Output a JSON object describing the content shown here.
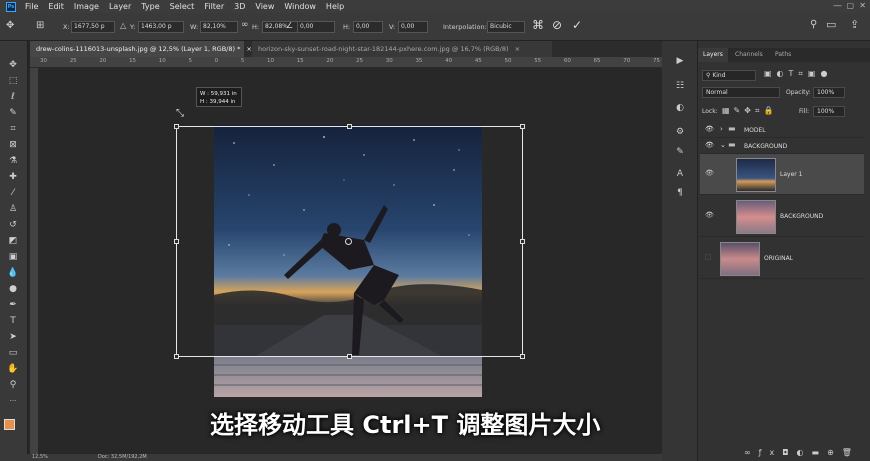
{
  "menu": [
    "File",
    "Edit",
    "Image",
    "Layer",
    "Type",
    "Select",
    "Filter",
    "3D",
    "View",
    "Window",
    "Help"
  ],
  "app_badge": "Ps",
  "options": {
    "x_label": "X:",
    "x_value": "1677,50 p",
    "y_label": "Y:",
    "y_value": "1463,00 p",
    "w_label": "W:",
    "w_value": "82,10%",
    "h_label": "H:",
    "h_value": "82,08%",
    "angle_value": "0,00",
    "hskew_label": "H:",
    "hskew_value": "0,00",
    "vskew_label": "V:",
    "vskew_value": "0,00",
    "interp_label": "Interpolation:",
    "interp_value": "Bicubic"
  },
  "tabs": [
    {
      "label": "drew-colins-1116013-unsplash.jpg @ 12,5% (Layer 1, RGB/8) *",
      "active": true
    },
    {
      "label": "horizon-sky-sunset-road-night-star-182144-pxhere.com.jpg @ 16,7% (RGB/8)",
      "active": false
    }
  ],
  "ruler_ticks": [
    "30",
    "25",
    "20",
    "15",
    "10",
    "5",
    "0",
    "5",
    "10",
    "15",
    "20",
    "25",
    "30",
    "35",
    "40",
    "45",
    "50",
    "55",
    "60",
    "65",
    "70",
    "75"
  ],
  "transform_tooltip": {
    "w": "W :  59,931 in",
    "h": "H :  39,944 in"
  },
  "subtitle": "选择移动工具 Ctrl+T 调整图片大小",
  "status": {
    "zoom": "12,5%",
    "doc": "Doc: 32,5M/192,2M"
  },
  "panel": {
    "tabs": [
      "Layers",
      "Channels",
      "Paths"
    ],
    "kind": "Kind",
    "blend_mode": "Normal",
    "opacity_label": "Opacity:",
    "opacity_value": "100%",
    "lock_label": "Lock:",
    "fill_label": "Fill:",
    "fill_value": "100%",
    "layers": [
      {
        "name": "MODEL",
        "type": "group"
      },
      {
        "name": "BACKGROUND",
        "type": "group"
      },
      {
        "name": "Layer 1",
        "type": "layer"
      },
      {
        "name": "BACKGROUND",
        "type": "layer"
      },
      {
        "name": "ORIGINAL",
        "type": "layer"
      }
    ]
  },
  "colors": {
    "accent": "#31a8ff",
    "foreground": "#e8904a",
    "background": "#000000"
  }
}
